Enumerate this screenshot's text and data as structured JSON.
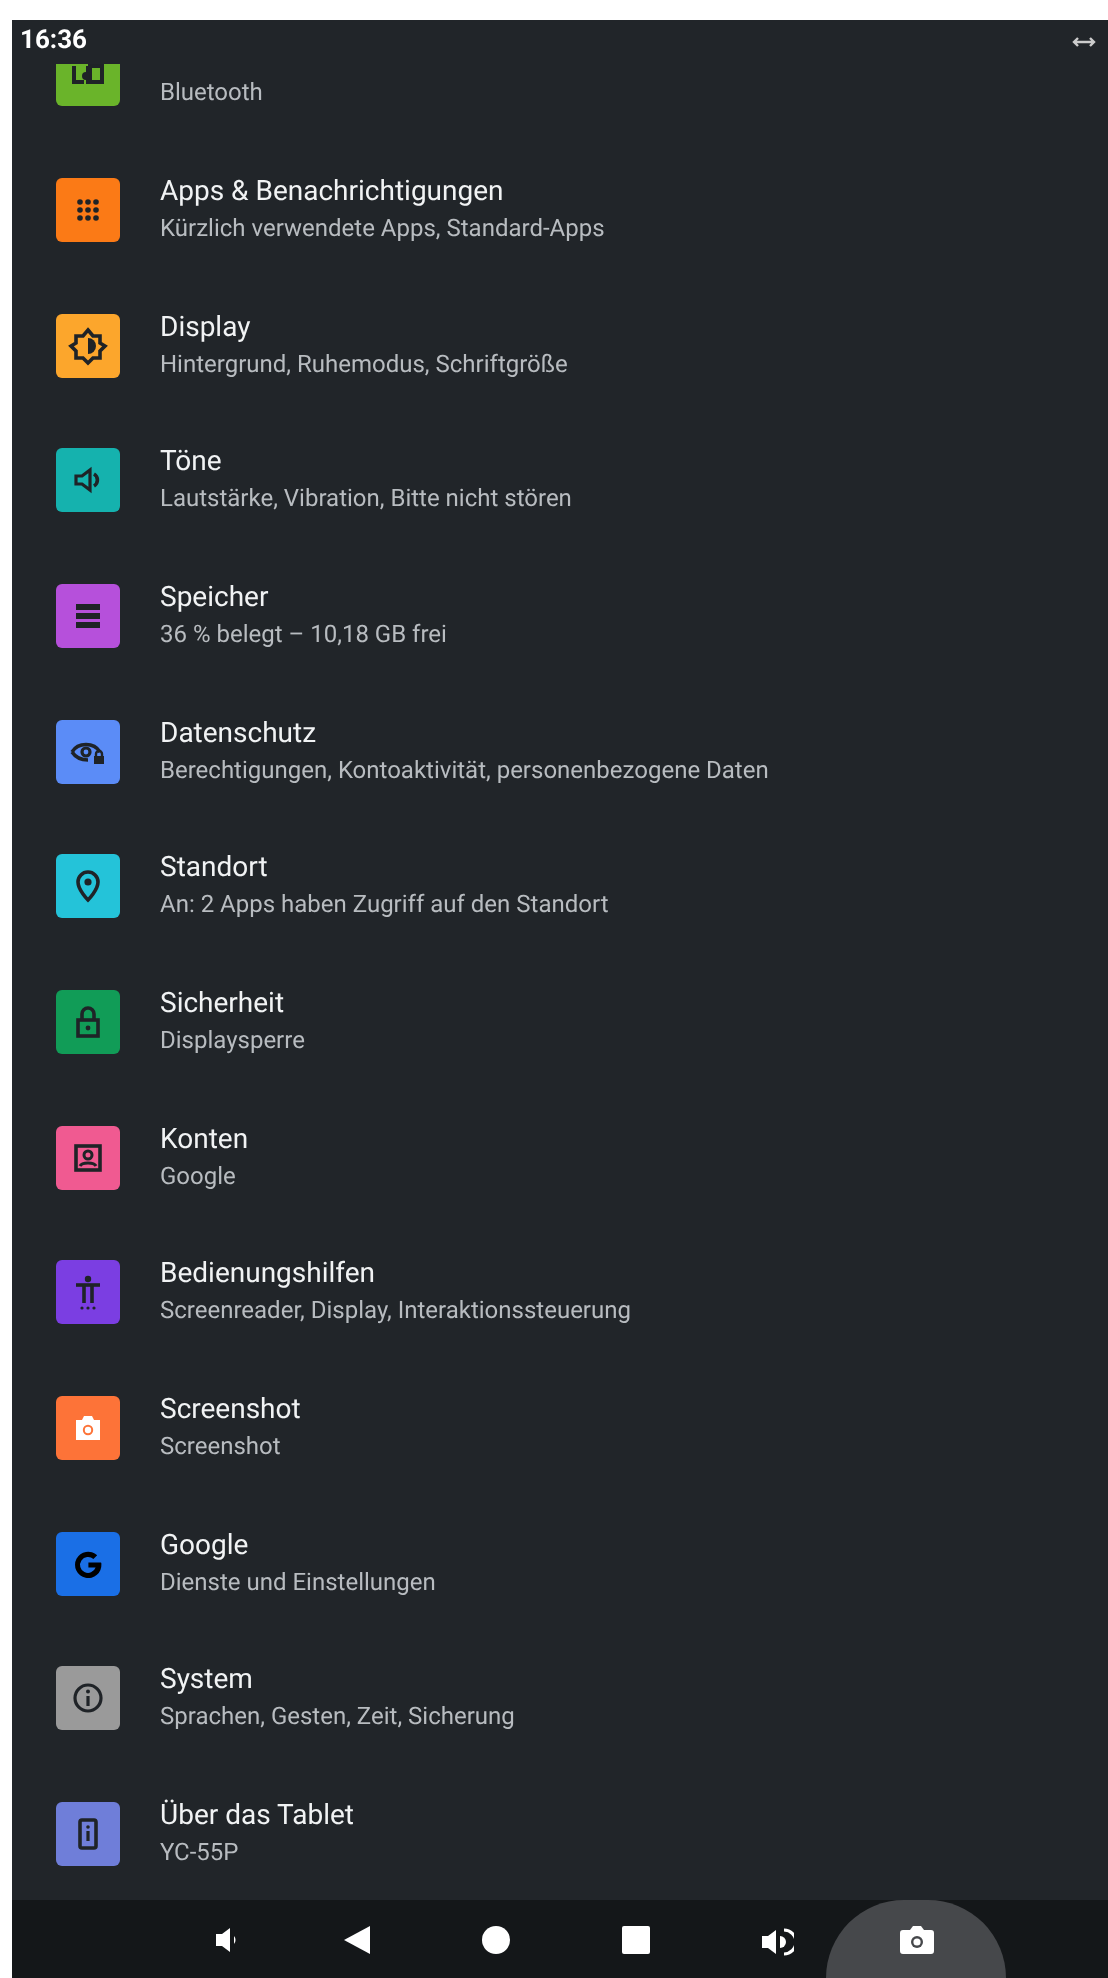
{
  "status_bar": {
    "time": "16:36"
  },
  "settings": [
    {
      "kind": "devices",
      "subtitle": "Bluetooth",
      "color": "#6ab42a"
    },
    {
      "kind": "apps",
      "title": "Apps & Benachrichtigungen",
      "subtitle": "Kürzlich verwendete Apps, Standard-Apps",
      "color": "#fb7a16"
    },
    {
      "kind": "display",
      "title": "Display",
      "subtitle": "Hintergrund, Ruhemodus, Schriftgröße",
      "color": "#fca62c"
    },
    {
      "kind": "sound",
      "title": "Töne",
      "subtitle": "Lautstärke, Vibration, Bitte nicht stören",
      "color": "#15b2ae"
    },
    {
      "kind": "storage",
      "title": "Speicher",
      "subtitle": "36 % belegt – 10,18 GB frei",
      "color": "#b650db"
    },
    {
      "kind": "privacy",
      "title": "Datenschutz",
      "subtitle": "Berechtigungen, Kontoaktivität, personenbezogene Daten",
      "color": "#5b8cf7"
    },
    {
      "kind": "location",
      "title": "Standort",
      "subtitle": "An: 2 Apps haben Zugriff auf den Standort",
      "color": "#24c3d9"
    },
    {
      "kind": "security",
      "title": "Sicherheit",
      "subtitle": "Displaysperre",
      "color": "#119c57"
    },
    {
      "kind": "accounts",
      "title": "Konten",
      "subtitle": "Google",
      "color": "#f05a91"
    },
    {
      "kind": "accessibility",
      "title": "Bedienungshilfen",
      "subtitle": "Screenreader, Display, Interaktionssteuerung",
      "color": "#7b3ee2"
    },
    {
      "kind": "screenshot",
      "title": "Screenshot",
      "subtitle": "Screenshot",
      "color": "#fd7338"
    },
    {
      "kind": "google",
      "title": "Google",
      "subtitle": "Dienste und Einstellungen",
      "color": "#1a6fe6"
    },
    {
      "kind": "system",
      "title": "System",
      "subtitle": "Sprachen, Gesten, Zeit, Sicherung",
      "color": "#9a9a9a"
    },
    {
      "kind": "about",
      "title": "Über das Tablet",
      "subtitle": "YC-55P",
      "color": "#6f7ed9"
    }
  ]
}
